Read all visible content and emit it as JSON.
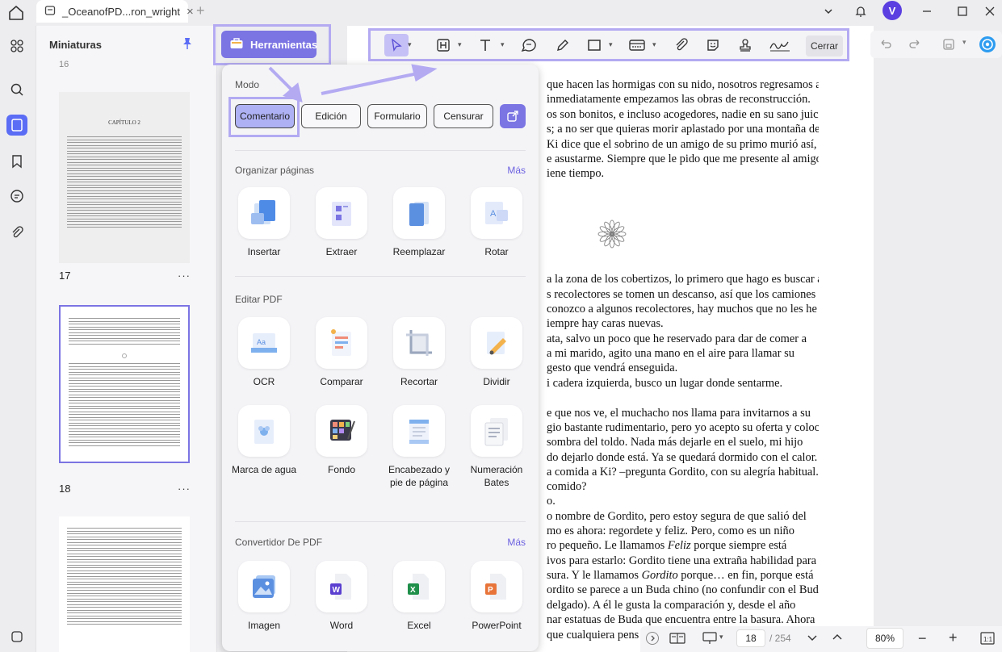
{
  "tab": {
    "title": "_OceanofPD...ron_wright",
    "close": "×",
    "new": "+"
  },
  "user": {
    "avatar_letter": "V"
  },
  "thumbnails": {
    "title": "Miniaturas",
    "top_num": "16",
    "pages": [
      {
        "number": "17",
        "heading": "CAPÍTULO 2",
        "more": "···"
      },
      {
        "number": "18",
        "more": "···"
      }
    ]
  },
  "toolbar": {
    "tools_label": "Herramientas",
    "close_label": "Cerrar"
  },
  "panel": {
    "mode_title": "Modo",
    "modes": [
      "Comentario",
      "Edición",
      "Formulario",
      "Censurar"
    ],
    "organize_title": "Organizar páginas",
    "organize_more": "Más",
    "organize_tools": [
      "Insertar",
      "Extraer",
      "Reemplazar",
      "Rotar"
    ],
    "edit_title": "Editar PDF",
    "edit_tools": [
      "OCR",
      "Comparar",
      "Recortar",
      "Dividir",
      "Marca de agua",
      "Fondo",
      "Encabezado y pie de página",
      "Numeración Bates"
    ],
    "converter_title": "Convertidor De PDF",
    "converter_more": "Más",
    "converter_tools": [
      "Imagen",
      "Word",
      "Excel",
      "PowerPoint"
    ]
  },
  "document": {
    "lines": [
      "que hacen las hormigas con su nido, nosotros regresamos al",
      "inmediatamente empezamos las obras de reconstrucción.",
      "os son bonitos, e incluso acogedores, nadie en su sano juicio",
      "s; a no ser que quieras morir aplastado por una montaña de",
      "Ki dice que el sobrino de un amigo de su primo murió así,",
      "e asustarme. Siempre que le pido que me presente al amigo",
      "iene tiempo.",
      "a la zona de los cobertizos, lo primero que hago es buscar a",
      "s recolectores se tomen un descanso, así que los camiones",
      "conozco a algunos recolectores, hay muchos que no les he",
      "iempre hay caras nuevas.",
      "ata, salvo un poco que he reservado para dar de comer a",
      "a mi marido, agito una mano en el aire para llamar su",
      "gesto que vendrá enseguida.",
      "i cadera izquierda, busco un lugar donde sentarme.",
      "e que nos ve, el muchacho nos llama para invitarnos a su",
      "gio bastante rudimentario, pero yo acepto su oferta y coloco",
      "sombra del toldo. Nada más dejarle en el suelo, mi hijo",
      "do dejarlo donde está. Ya se quedará dormido con el calor.",
      "a comida a Ki? –pregunta Gordito, con su alegría habitual.",
      "comido?",
      "o.",
      "o nombre de Gordito, pero estoy segura de que salió del",
      "mo es ahora: regordete y feliz. Pero, como es un niño",
      "ro pequeño. Le llamamos Feliz porque siempre está",
      "ivos para estarlo: Gordito tiene una extraña habilidad para",
      "sura. Y le llamamos Gordito porque… en fin, porque está",
      "ordito se parece a un Buda chino (no confundir con el Buda",
      "delgado). A él le gusta la comparación y, desde el año",
      "nar estatuas de Buda que encuentra entre la basura. Ahora",
      "que cualquiera pens"
    ]
  },
  "bottombar": {
    "page_current": "18",
    "page_total": "/ 254",
    "zoom": "80%"
  }
}
